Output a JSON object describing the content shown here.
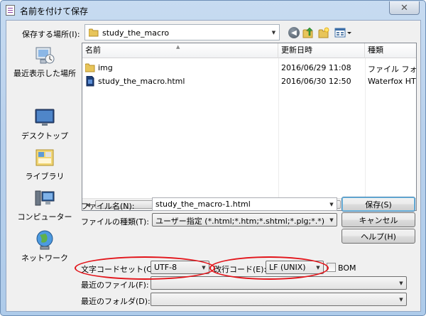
{
  "window": {
    "title": "名前を付けて保存",
    "close_symbol": "✕"
  },
  "location": {
    "label": "保存する場所(I):",
    "value": "study_the_macro"
  },
  "places": [
    {
      "label": "最近表示した場所",
      "icon": "recent-places-icon"
    },
    {
      "label": "デスクトップ",
      "icon": "desktop-icon"
    },
    {
      "label": "ライブラリ",
      "icon": "libraries-icon"
    },
    {
      "label": "コンピューター",
      "icon": "computer-icon"
    },
    {
      "label": "ネットワーク",
      "icon": "network-icon"
    }
  ],
  "file_list": {
    "columns": {
      "name": "名前",
      "date": "更新日時",
      "type": "種類"
    },
    "rows": [
      {
        "icon": "folder-icon",
        "name": "img",
        "date": "2016/06/29 11:08",
        "type": "ファイル フォ"
      },
      {
        "icon": "html-file-icon",
        "name": "study_the_macro.html",
        "date": "2016/06/30 12:50",
        "type": "Waterfox HTN"
      }
    ]
  },
  "form": {
    "filename_label": "ファイル名(N):",
    "filename_value": "study_the_macro-1.html",
    "filetype_label": "ファイルの種類(T):",
    "filetype_value": "ユーザー指定 (*.html;*.htm;*.shtml;*.plg;*.*)",
    "charset_label": "文字コードセット(C):",
    "charset_value": "UTF-8",
    "newline_label": "改行コード(E):",
    "newline_value": "LF (UNIX)",
    "bom_label": "BOM",
    "bom_checked": false,
    "recent_file_label": "最近のファイル(F):",
    "recent_file_value": "",
    "recent_folder_label": "最近のフォルダ(D):",
    "recent_folder_value": ""
  },
  "buttons": {
    "save": "保存(S)",
    "cancel": "キャンセル",
    "help": "ヘルプ(H)"
  },
  "colors": {
    "highlight_ellipse": "#e2141a",
    "default_button_border": "#3c7fb1"
  }
}
